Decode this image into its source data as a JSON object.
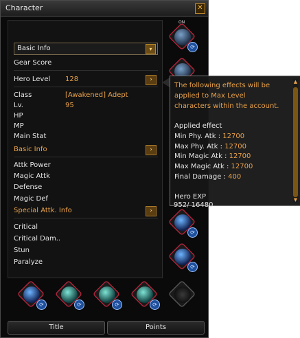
{
  "window": {
    "title": "Character",
    "close": "✕"
  },
  "dropdown": {
    "selected": "Basic Info",
    "arrow": "▾"
  },
  "rows": {
    "gear_score": "Gear Score",
    "hero_level_label": "Hero Level",
    "hero_level_value": "128",
    "class_label": "Class",
    "class_value": "[Awakened] Adept",
    "lv_label": "Lv.",
    "lv_value": "95",
    "hp": "HP",
    "mp": "MP",
    "main_stat": "Main Stat",
    "basic_info": "Basic Info",
    "attk_power": "Attk Power",
    "magic_attk": "Magic Attk",
    "defense": "Defense",
    "magic_def": "Magic Def",
    "special_attk": "Special Attk. Info",
    "critical": "Critical",
    "critical_dam": "Critical Dam..",
    "stun": "Stun",
    "paralyze": "Paralyze",
    "arrow": "›"
  },
  "tabs": {
    "title": "Title",
    "points": "Points"
  },
  "slots": {
    "badge": "⟳",
    "on_off": "ON"
  },
  "tooltip": {
    "header1": "The following effects will be",
    "header2": "applied to Max Level",
    "header3": "characters within the account.",
    "applied": "Applied effect",
    "min_phy_label": "Min Phy. Atk :",
    "min_phy_value": "12700",
    "max_phy_label": "Max Phy. Atk :",
    "max_phy_value": "12700",
    "min_mag_label": "Min Magic Atk :",
    "min_mag_value": "12700",
    "max_mag_label": "Max Magic Atk :",
    "max_mag_value": "12700",
    "final_label": "Final Damage :",
    "final_value": "400",
    "hero_exp": "Hero EXP",
    "hero_exp_value": "952/ 16480",
    "scroll_up": "▲",
    "scroll_down": "▼"
  },
  "colors": {
    "accent": "#e9a24a",
    "slot_border": "#b0243b",
    "badge": "#1d4f9c"
  }
}
